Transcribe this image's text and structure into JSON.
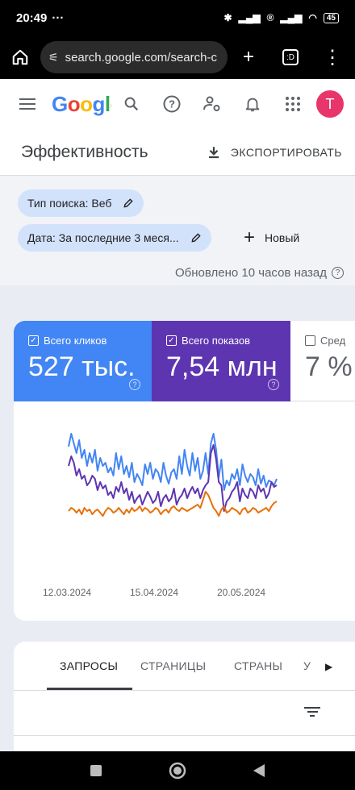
{
  "status": {
    "time": "20:49",
    "dots": "···",
    "battery": "45"
  },
  "browser": {
    "url": "search.google.com/search-c",
    "tab_count": ":D"
  },
  "header": {
    "logo": "Google",
    "avatar_letter": "T"
  },
  "page": {
    "title": "Эффективность",
    "export_label": "ЭКСПОРТИРОВАТЬ"
  },
  "filters": {
    "search_type": "Тип поиска: Веб",
    "date": "Дата: За последние 3 меся...",
    "new_label": "Новый",
    "updated": "Обновлено 10 часов назад"
  },
  "metrics": [
    {
      "label": "Всего кликов",
      "value": "527 тыс.",
      "checked": true,
      "color": "#4285f4"
    },
    {
      "label": "Всего показов",
      "value": "7,54 млн",
      "checked": true,
      "color": "#5e35b1"
    },
    {
      "label": "Сред",
      "value": "7 %",
      "checked": false,
      "color": "#ffffff"
    }
  ],
  "chart_data": {
    "type": "line",
    "x_ticks": [
      "12.03.2024",
      "15.04.2024",
      "20.05.2024"
    ],
    "series": [
      {
        "color": "#4285f4",
        "values": [
          62,
          70,
          64,
          58,
          66,
          55,
          60,
          50,
          58,
          52,
          60,
          47,
          55,
          50,
          52,
          46,
          49,
          44,
          58,
          48,
          56,
          45,
          50,
          43,
          52,
          40,
          45,
          42,
          38,
          51,
          45,
          52,
          42,
          48,
          46,
          40,
          52,
          44,
          39,
          46,
          48,
          42,
          56,
          45,
          60,
          50,
          44,
          58,
          47,
          55,
          42,
          47,
          58,
          45,
          64,
          70,
          60,
          43,
          54,
          35,
          41,
          38,
          45,
          42,
          48,
          38,
          51,
          44,
          40,
          45,
          43,
          38,
          48,
          39,
          44,
          37,
          41,
          40,
          38,
          42
        ]
      },
      {
        "color": "#5e35b1",
        "values": [
          50,
          56,
          52,
          44,
          48,
          42,
          44,
          38,
          40,
          44,
          42,
          35,
          40,
          36,
          38,
          32,
          34,
          30,
          37,
          34,
          40,
          33,
          36,
          29,
          34,
          27,
          30,
          32,
          26,
          30,
          34,
          31,
          27,
          29,
          34,
          25,
          30,
          32,
          28,
          30,
          36,
          26,
          30,
          32,
          36,
          30,
          34,
          37,
          33,
          36,
          30,
          35,
          38,
          40,
          58,
          63,
          54,
          40,
          38,
          22,
          28,
          30,
          34,
          36,
          40,
          28,
          36,
          32,
          30,
          36,
          34,
          30,
          38,
          34,
          36,
          30,
          33,
          40,
          37,
          38
        ]
      },
      {
        "color": "#e8710a",
        "values": [
          22,
          24,
          23,
          21,
          23,
          20,
          24,
          22,
          23,
          20,
          22,
          23,
          21,
          19,
          22,
          24,
          23,
          21,
          22,
          24,
          22,
          20,
          23,
          21,
          24,
          22,
          23,
          25,
          22,
          24,
          23,
          21,
          22,
          24,
          23,
          20,
          22,
          23,
          21,
          24,
          25,
          23,
          22,
          24,
          23,
          22,
          23,
          24,
          25,
          26,
          24,
          29,
          34,
          32,
          28,
          24,
          22,
          19,
          23,
          25,
          21,
          22,
          24,
          23,
          22,
          20,
          23,
          24,
          21,
          22,
          24,
          23,
          21,
          22,
          23,
          24,
          22,
          25,
          27,
          28
        ]
      }
    ]
  },
  "tabs": [
    "ЗАПРОСЫ",
    "СТРАНИЦЫ",
    "СТРАНЫ",
    "У"
  ]
}
